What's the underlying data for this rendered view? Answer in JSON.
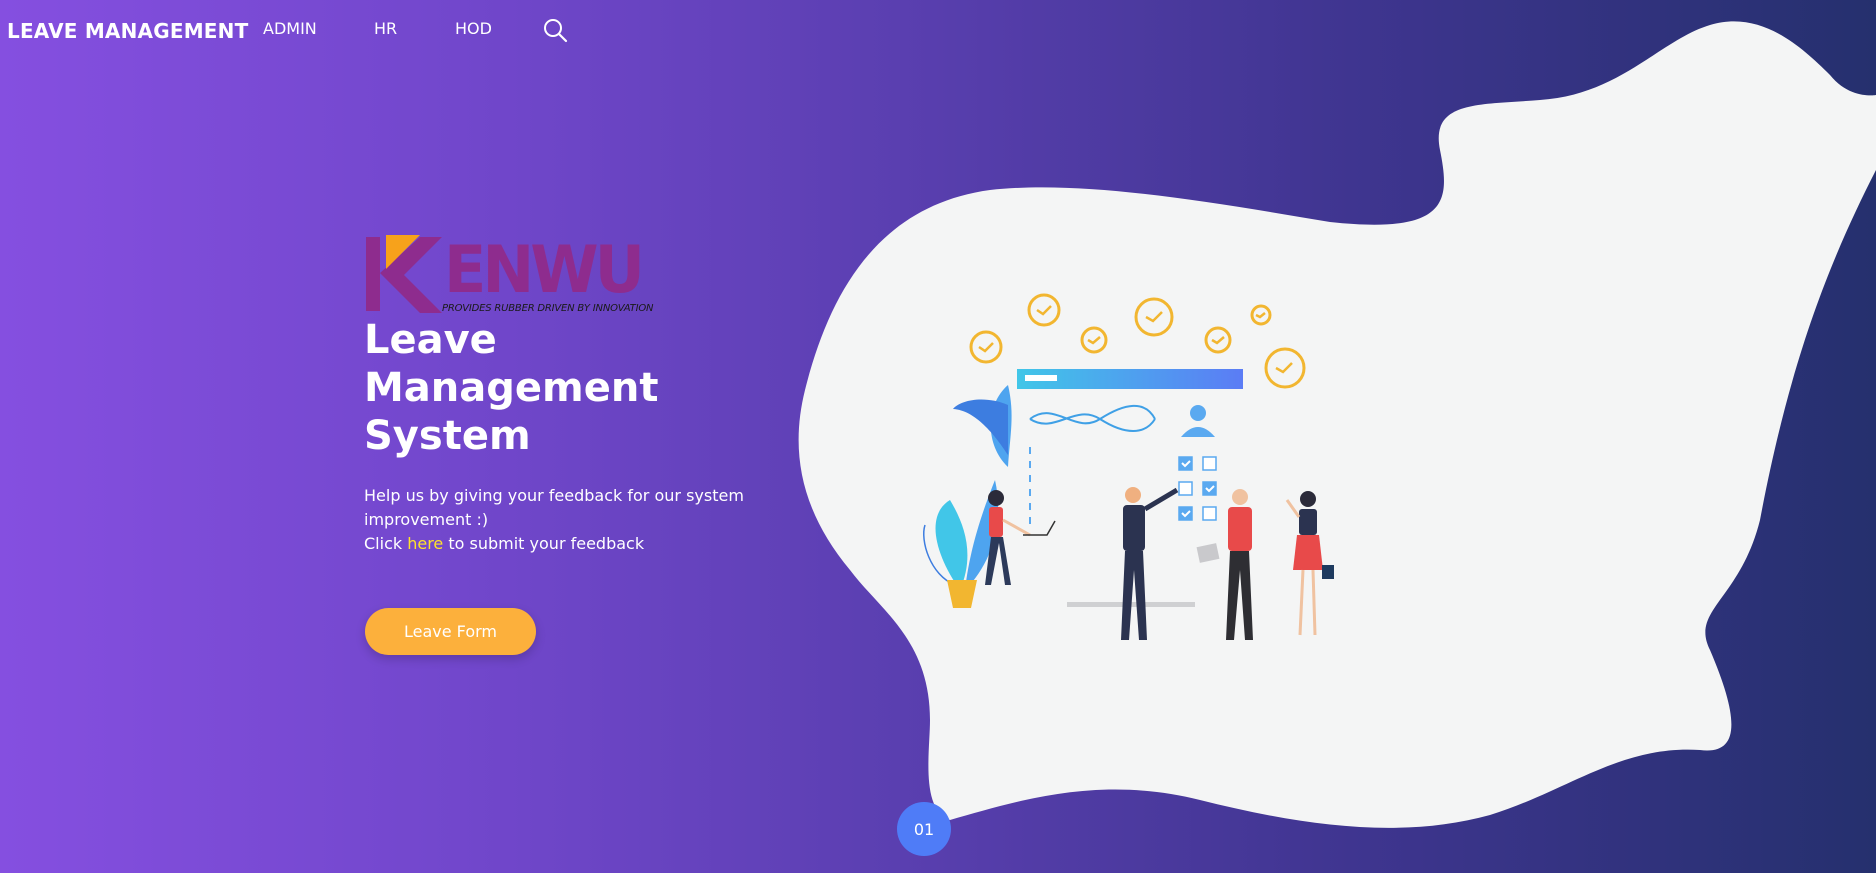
{
  "nav": {
    "brand": "LEAVE MANAGEMENT",
    "links": [
      "ADMIN",
      "HR",
      "HOD"
    ],
    "search_icon": "search-icon"
  },
  "logo": {
    "wordmark": "KENWU",
    "tagline": "PROVIDES RUBBER DRIVEN BY INNOVATION"
  },
  "hero": {
    "title_lines": [
      "Leave",
      "Management",
      "System"
    ],
    "description": "Help us by giving your feedback for our system improvement :)",
    "click_prefix": "Click ",
    "click_link": "here",
    "click_suffix": " to submit your feedback",
    "button_label": "Leave Form"
  },
  "slide_indicator": "01",
  "colors": {
    "gradient_start": "#854fe0",
    "gradient_end": "#25306e",
    "blob": "#f4f5f5",
    "button": "#fcb03c",
    "link": "#ffe22b",
    "indicator": "#4f7cf7",
    "logo": "#8e2c8e"
  }
}
